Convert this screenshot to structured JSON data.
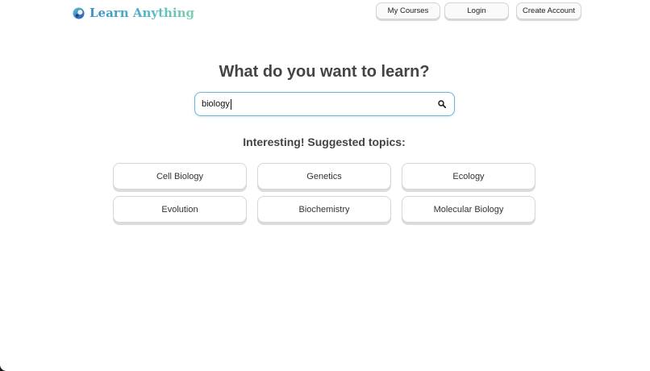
{
  "brand": {
    "name": "Learn Anything",
    "logo_icon": "learn-anything-logo-icon",
    "colors": [
      "#3a8fc9",
      "#4fb8c8",
      "#7fd1b0"
    ]
  },
  "nav": {
    "my_courses": "My Courses",
    "login": "Login",
    "create_account": "Create Account"
  },
  "hero": {
    "headline": "What do you want to learn?"
  },
  "search": {
    "value": "biology",
    "icon": "search-icon",
    "border_color": "#6bb6d6"
  },
  "suggestions": {
    "title": "Interesting! Suggested topics:",
    "topics": [
      "Cell Biology",
      "Genetics",
      "Ecology",
      "Evolution",
      "Biochemistry",
      "Molecular Biology"
    ]
  }
}
